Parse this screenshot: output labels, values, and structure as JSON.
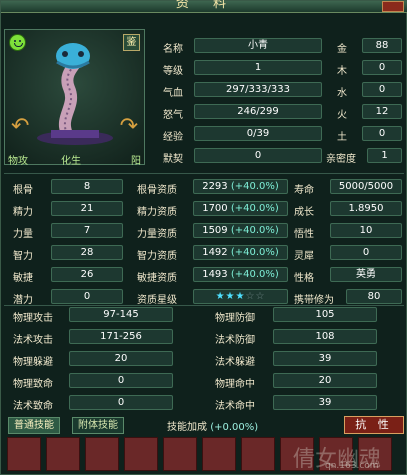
{
  "window": {
    "title": "资 料"
  },
  "portrait": {
    "jian_label": "鉴",
    "left_tag": "物攻",
    "mid_tag": "化生",
    "right_tag": "阳"
  },
  "info": {
    "name_label": "名称",
    "name": "小青",
    "level_label": "等级",
    "level": "1",
    "hp_label": "气血",
    "hp": "297/333/333",
    "rage_label": "怒气",
    "rage": "246/299",
    "exp_label": "经验",
    "exp": "0/39",
    "tacit_label": "默契",
    "tacit": "0"
  },
  "elements": [
    {
      "label": "金",
      "value": "88"
    },
    {
      "label": "木",
      "value": "0"
    },
    {
      "label": "水",
      "value": "0"
    },
    {
      "label": "火",
      "value": "12"
    },
    {
      "label": "土",
      "value": "0"
    },
    {
      "label": "亲密度",
      "value": "1"
    }
  ],
  "stats": [
    {
      "label": "根骨",
      "value": "8",
      "apt_label": "根骨资质",
      "apt": "2293",
      "bonus": "(+40.0%)",
      "r_label": "寿命",
      "r_value": "5000/5000"
    },
    {
      "label": "精力",
      "value": "21",
      "apt_label": "精力资质",
      "apt": "1700",
      "bonus": "(+40.0%)",
      "r_label": "成长",
      "r_value": "1.8950"
    },
    {
      "label": "力量",
      "value": "7",
      "apt_label": "力量资质",
      "apt": "1509",
      "bonus": "(+40.0%)",
      "r_label": "悟性",
      "r_value": "10"
    },
    {
      "label": "智力",
      "value": "28",
      "apt_label": "智力资质",
      "apt": "1492",
      "bonus": "(+40.0%)",
      "r_label": "灵犀",
      "r_value": "0"
    },
    {
      "label": "敏捷",
      "value": "26",
      "apt_label": "敏捷资质",
      "apt": "1493",
      "bonus": "(+40.0%)",
      "r_label": "性格",
      "r_value": "英勇"
    }
  ],
  "potential": {
    "label": "潜力",
    "value": "0",
    "star_label": "资质星级",
    "stars": 3,
    "stars_max": 5,
    "r_label": "携带修为",
    "r_value": "80"
  },
  "combat": [
    {
      "l_label": "物理攻击",
      "l_value": "97-145",
      "r_label": "物理防御",
      "r_value": "105"
    },
    {
      "l_label": "法术攻击",
      "l_value": "171-256",
      "r_label": "法术防御",
      "r_value": "108"
    },
    {
      "l_label": "物理躲避",
      "l_value": "20",
      "r_label": "法术躲避",
      "r_value": "39"
    },
    {
      "l_label": "物理致命",
      "l_value": "0",
      "r_label": "物理命中",
      "r_value": "20"
    },
    {
      "l_label": "法术致命",
      "l_value": "0",
      "r_label": "法术命中",
      "r_value": "39"
    }
  ],
  "skills": {
    "tab_normal": "普通技能",
    "tab_attached": "附体技能",
    "bonus_label": "技能加成",
    "bonus_value": "(+0.00%)",
    "resist_button": "抗 性"
  },
  "watermark": {
    "text": "倩女幽魂",
    "site": "qn.163.com"
  }
}
